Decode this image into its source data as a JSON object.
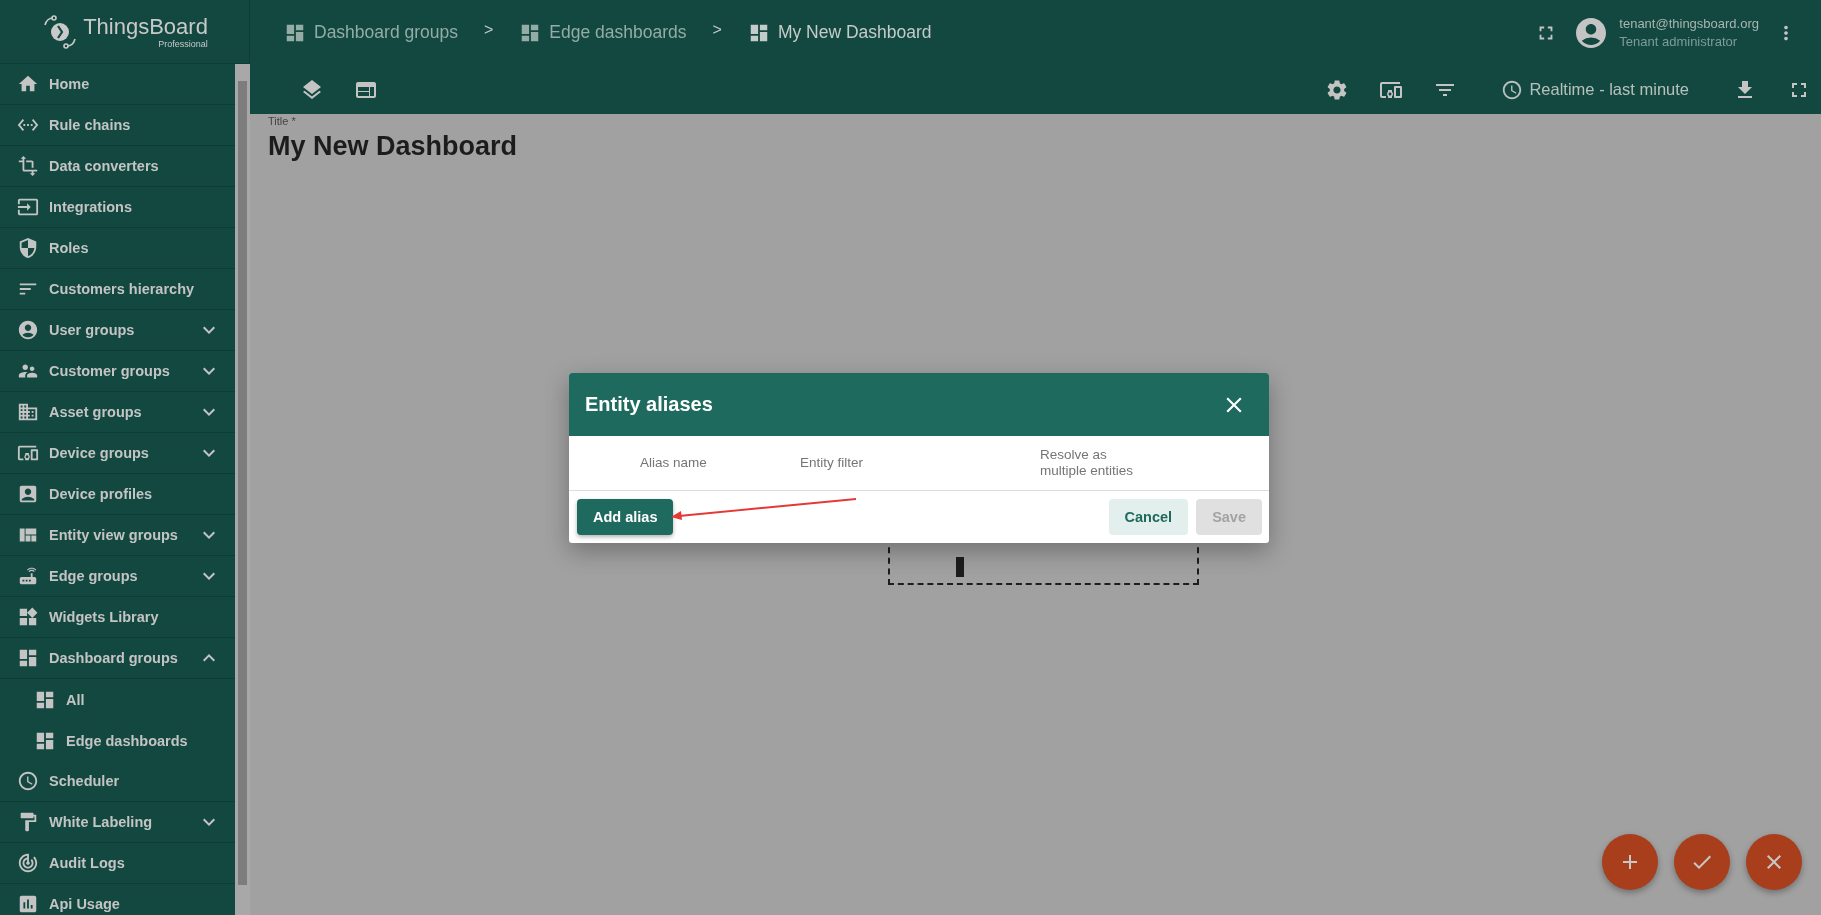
{
  "logo": {
    "name": "ThingsBoard",
    "edition": "Professional"
  },
  "breadcrumbs": [
    {
      "label": "Dashboard groups",
      "current": false
    },
    {
      "label": ">",
      "kind": "separator"
    },
    {
      "label": "Edge dashboards",
      "current": false
    },
    {
      "label": ">",
      "kind": "separator"
    },
    {
      "label": "My New Dashboard",
      "current": true
    }
  ],
  "user": {
    "email": "tenant@thingsboard.org",
    "role": "Tenant administrator"
  },
  "toolbar": {
    "timewindow": "Realtime - last minute"
  },
  "sidebar": {
    "items": [
      {
        "label": "Home",
        "kind": "link"
      },
      {
        "label": "Rule chains",
        "kind": "link"
      },
      {
        "label": "Data converters",
        "kind": "link"
      },
      {
        "label": "Integrations",
        "kind": "link"
      },
      {
        "label": "Roles",
        "kind": "link"
      },
      {
        "label": "Customers hierarchy",
        "kind": "link"
      },
      {
        "label": "User groups",
        "kind": "group",
        "expanded": false
      },
      {
        "label": "Customer groups",
        "kind": "group",
        "expanded": false
      },
      {
        "label": "Asset groups",
        "kind": "group",
        "expanded": false
      },
      {
        "label": "Device groups",
        "kind": "group",
        "expanded": false
      },
      {
        "label": "Device profiles",
        "kind": "link"
      },
      {
        "label": "Entity view groups",
        "kind": "group",
        "expanded": false
      },
      {
        "label": "Edge groups",
        "kind": "group",
        "expanded": false
      },
      {
        "label": "Widgets Library",
        "kind": "link"
      },
      {
        "label": "Dashboard groups",
        "kind": "group",
        "expanded": true,
        "children": [
          {
            "label": "All"
          },
          {
            "label": "Edge dashboards"
          }
        ]
      },
      {
        "label": "Scheduler",
        "kind": "link"
      },
      {
        "label": "White Labeling",
        "kind": "group",
        "expanded": false
      },
      {
        "label": "Audit Logs",
        "kind": "link"
      },
      {
        "label": "Api Usage",
        "kind": "link"
      }
    ]
  },
  "dashboard_title": {
    "label": "Title *",
    "value": "My New Dashboard"
  },
  "dialog": {
    "title": "Entity aliases",
    "columns": [
      "Alias name",
      "Entity filter",
      "Resolve as multiple entities"
    ],
    "buttons": [
      {
        "label": "Add alias",
        "kind": "primary",
        "disabled": false
      },
      {
        "label": "Cancel",
        "kind": "secondary",
        "disabled": false
      },
      {
        "label": "Save",
        "kind": "secondary",
        "disabled": true
      }
    ]
  },
  "fabs": [
    {
      "kind": "add"
    },
    {
      "kind": "apply"
    },
    {
      "kind": "close"
    }
  ]
}
